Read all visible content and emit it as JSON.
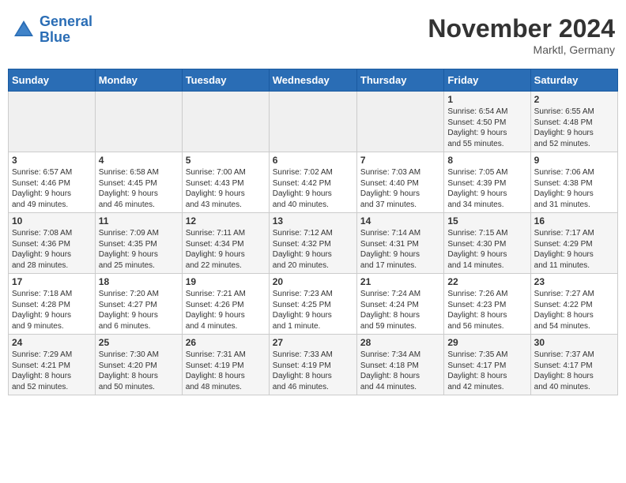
{
  "header": {
    "logo_line1": "General",
    "logo_line2": "Blue",
    "month_title": "November 2024",
    "location": "Marktl, Germany"
  },
  "days_of_week": [
    "Sunday",
    "Monday",
    "Tuesday",
    "Wednesday",
    "Thursday",
    "Friday",
    "Saturday"
  ],
  "weeks": [
    [
      {
        "day": "",
        "info": ""
      },
      {
        "day": "",
        "info": ""
      },
      {
        "day": "",
        "info": ""
      },
      {
        "day": "",
        "info": ""
      },
      {
        "day": "",
        "info": ""
      },
      {
        "day": "1",
        "info": "Sunrise: 6:54 AM\nSunset: 4:50 PM\nDaylight: 9 hours\nand 55 minutes."
      },
      {
        "day": "2",
        "info": "Sunrise: 6:55 AM\nSunset: 4:48 PM\nDaylight: 9 hours\nand 52 minutes."
      }
    ],
    [
      {
        "day": "3",
        "info": "Sunrise: 6:57 AM\nSunset: 4:46 PM\nDaylight: 9 hours\nand 49 minutes."
      },
      {
        "day": "4",
        "info": "Sunrise: 6:58 AM\nSunset: 4:45 PM\nDaylight: 9 hours\nand 46 minutes."
      },
      {
        "day": "5",
        "info": "Sunrise: 7:00 AM\nSunset: 4:43 PM\nDaylight: 9 hours\nand 43 minutes."
      },
      {
        "day": "6",
        "info": "Sunrise: 7:02 AM\nSunset: 4:42 PM\nDaylight: 9 hours\nand 40 minutes."
      },
      {
        "day": "7",
        "info": "Sunrise: 7:03 AM\nSunset: 4:40 PM\nDaylight: 9 hours\nand 37 minutes."
      },
      {
        "day": "8",
        "info": "Sunrise: 7:05 AM\nSunset: 4:39 PM\nDaylight: 9 hours\nand 34 minutes."
      },
      {
        "day": "9",
        "info": "Sunrise: 7:06 AM\nSunset: 4:38 PM\nDaylight: 9 hours\nand 31 minutes."
      }
    ],
    [
      {
        "day": "10",
        "info": "Sunrise: 7:08 AM\nSunset: 4:36 PM\nDaylight: 9 hours\nand 28 minutes."
      },
      {
        "day": "11",
        "info": "Sunrise: 7:09 AM\nSunset: 4:35 PM\nDaylight: 9 hours\nand 25 minutes."
      },
      {
        "day": "12",
        "info": "Sunrise: 7:11 AM\nSunset: 4:34 PM\nDaylight: 9 hours\nand 22 minutes."
      },
      {
        "day": "13",
        "info": "Sunrise: 7:12 AM\nSunset: 4:32 PM\nDaylight: 9 hours\nand 20 minutes."
      },
      {
        "day": "14",
        "info": "Sunrise: 7:14 AM\nSunset: 4:31 PM\nDaylight: 9 hours\nand 17 minutes."
      },
      {
        "day": "15",
        "info": "Sunrise: 7:15 AM\nSunset: 4:30 PM\nDaylight: 9 hours\nand 14 minutes."
      },
      {
        "day": "16",
        "info": "Sunrise: 7:17 AM\nSunset: 4:29 PM\nDaylight: 9 hours\nand 11 minutes."
      }
    ],
    [
      {
        "day": "17",
        "info": "Sunrise: 7:18 AM\nSunset: 4:28 PM\nDaylight: 9 hours\nand 9 minutes."
      },
      {
        "day": "18",
        "info": "Sunrise: 7:20 AM\nSunset: 4:27 PM\nDaylight: 9 hours\nand 6 minutes."
      },
      {
        "day": "19",
        "info": "Sunrise: 7:21 AM\nSunset: 4:26 PM\nDaylight: 9 hours\nand 4 minutes."
      },
      {
        "day": "20",
        "info": "Sunrise: 7:23 AM\nSunset: 4:25 PM\nDaylight: 9 hours\nand 1 minute."
      },
      {
        "day": "21",
        "info": "Sunrise: 7:24 AM\nSunset: 4:24 PM\nDaylight: 8 hours\nand 59 minutes."
      },
      {
        "day": "22",
        "info": "Sunrise: 7:26 AM\nSunset: 4:23 PM\nDaylight: 8 hours\nand 56 minutes."
      },
      {
        "day": "23",
        "info": "Sunrise: 7:27 AM\nSunset: 4:22 PM\nDaylight: 8 hours\nand 54 minutes."
      }
    ],
    [
      {
        "day": "24",
        "info": "Sunrise: 7:29 AM\nSunset: 4:21 PM\nDaylight: 8 hours\nand 52 minutes."
      },
      {
        "day": "25",
        "info": "Sunrise: 7:30 AM\nSunset: 4:20 PM\nDaylight: 8 hours\nand 50 minutes."
      },
      {
        "day": "26",
        "info": "Sunrise: 7:31 AM\nSunset: 4:19 PM\nDaylight: 8 hours\nand 48 minutes."
      },
      {
        "day": "27",
        "info": "Sunrise: 7:33 AM\nSunset: 4:19 PM\nDaylight: 8 hours\nand 46 minutes."
      },
      {
        "day": "28",
        "info": "Sunrise: 7:34 AM\nSunset: 4:18 PM\nDaylight: 8 hours\nand 44 minutes."
      },
      {
        "day": "29",
        "info": "Sunrise: 7:35 AM\nSunset: 4:17 PM\nDaylight: 8 hours\nand 42 minutes."
      },
      {
        "day": "30",
        "info": "Sunrise: 7:37 AM\nSunset: 4:17 PM\nDaylight: 8 hours\nand 40 minutes."
      }
    ]
  ]
}
